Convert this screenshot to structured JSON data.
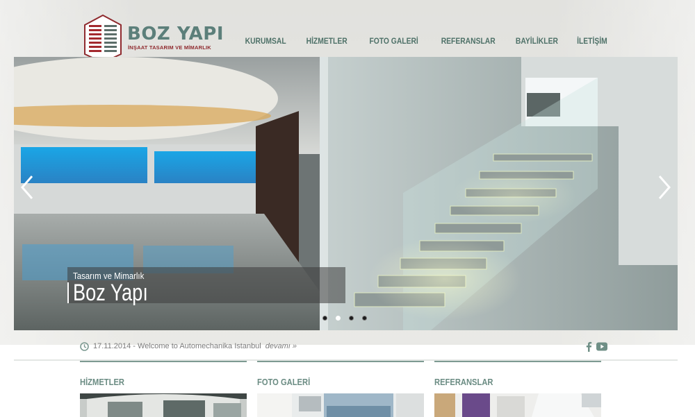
{
  "brand": {
    "name": "BOZ YAPI",
    "tagline": "İNŞAAT TASARIM VE MİMARLIK"
  },
  "nav": {
    "items": [
      "KURUMSAL",
      "HİZMETLER",
      "FOTO GALERİ",
      "REFERANSLAR",
      "BAYİLİKLER",
      "İLETİŞİM"
    ]
  },
  "slider": {
    "caption_small": "Tasarım ve Mimarlık",
    "caption_big": "Boz Yapı",
    "active_slide": 2,
    "slide_count": 4
  },
  "news": {
    "text": "17.11.2014 - Welcome to Automechanika Istanbul",
    "more": "devamı »"
  },
  "sections": {
    "hizmetler": "HİZMETLER",
    "galeri": "FOTO GALERİ",
    "referanslar": "REFERANSLAR"
  },
  "colors": {
    "accent": "#5c7f7a",
    "brand_red": "#8f2a2e",
    "section_title": "#6b8c83"
  },
  "icons": {
    "clock": "clock-icon",
    "facebook": "facebook-icon",
    "youtube": "youtube-icon",
    "prev": "chevron-left-icon",
    "next": "chevron-right-icon"
  }
}
